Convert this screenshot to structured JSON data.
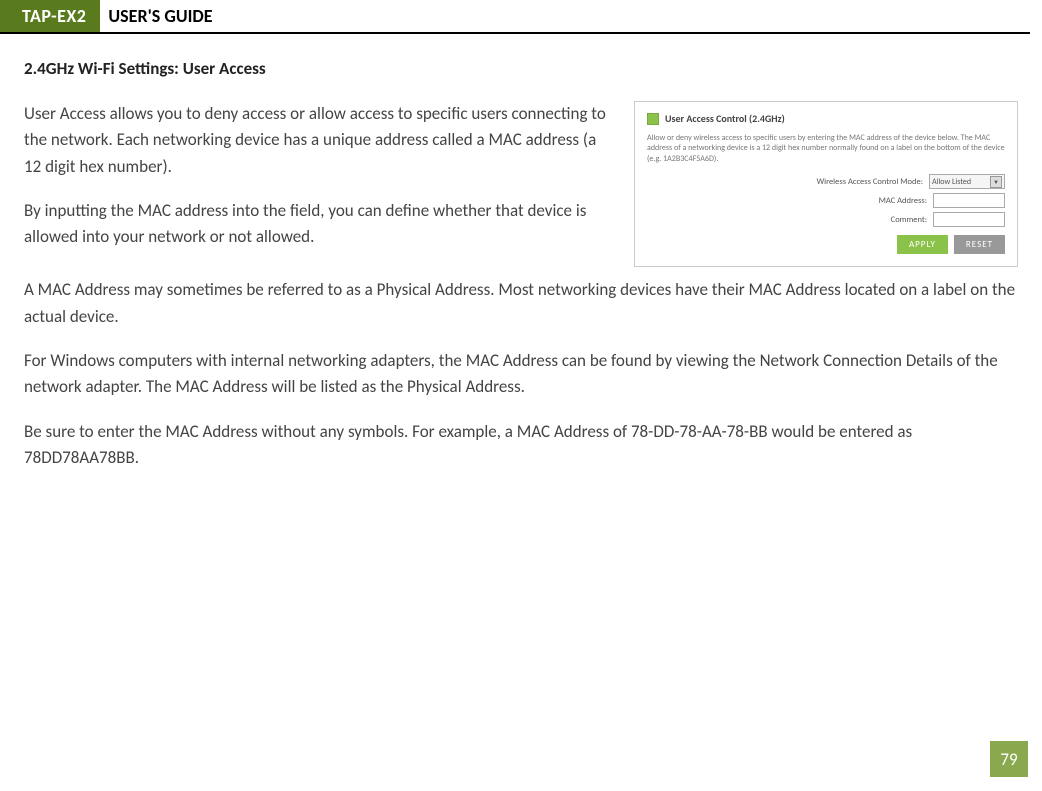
{
  "header": {
    "product": "TAP-EX2",
    "title": "USER'S GUIDE"
  },
  "section_heading": "2.4GHz Wi-Fi Settings: User Access",
  "paragraphs": {
    "p1": "User Access allows you to deny access or allow access to specific users connecting to the network. Each networking device has a unique address called a MAC address (a 12 digit hex number).",
    "p2": "By inputting the MAC address into the field, you can define whether that device is allowed into your network or not allowed.",
    "p3": "A MAC Address may sometimes be referred to as a Physical Address. Most networking devices have their MAC Address located on a label on the actual device.",
    "p4": "For Windows computers with internal networking adapters, the MAC Address can be found by viewing the Network Connection Details of the network adapter. The MAC Address will be listed as the Physical Address.",
    "p5": "Be sure to enter the MAC Address without any symbols. For example, a MAC Address of 78-DD-78-AA-78-BB would be entered as 78DD78AA78BB."
  },
  "panel": {
    "title": "User Access Control (2.4GHz)",
    "desc": "Allow or deny wireless access to specific users by entering the MAC address of the device below. The MAC address of a networking device is a 12 digit hex number normally found on a label on the bottom of the device (e.g. 1A2B3C4F5A6D).",
    "mode_label": "Wireless Access Control Mode:",
    "mode_value": "Allow Listed",
    "mac_label": "MAC Address:",
    "comment_label": "Comment:",
    "apply": "APPLY",
    "reset": "RESET"
  },
  "page_number": "79"
}
